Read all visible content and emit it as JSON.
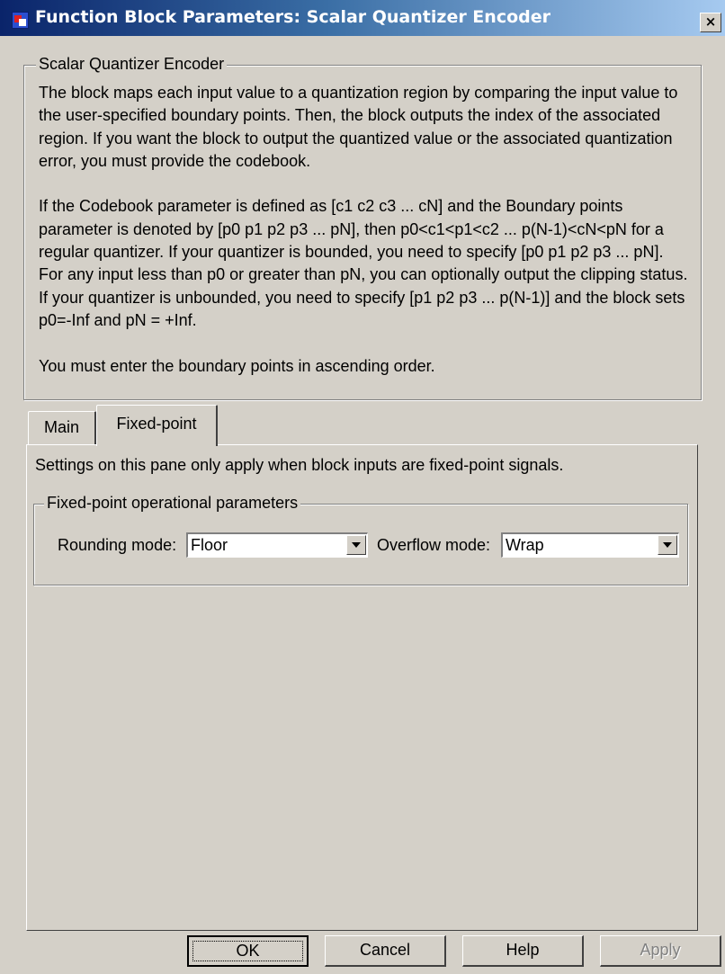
{
  "window": {
    "title": "Function Block Parameters: Scalar Quantizer Encoder",
    "close_label": "×"
  },
  "description_group": {
    "title": "Scalar Quantizer Encoder",
    "paragraphs": [
      "The block maps each input value to a quantization region by comparing the input value to the user-specified boundary points. Then, the block outputs the index of the associated region. If you want the block to output the quantized value or the associated quantization error, you must provide the codebook.",
      "If the Codebook parameter is defined as [c1 c2 c3 ... cN] and the Boundary points parameter is denoted by [p0 p1 p2 p3 ... pN], then p0<c1<p1<c2 ... p(N-1)<cN<pN for a regular quantizer. If your quantizer is bounded, you need to specify [p0 p1 p2 p3 ... pN]. For any input less than p0 or greater than pN, you can optionally output the clipping status. If your quantizer is unbounded, you need to specify [p1 p2 p3 ... p(N-1)] and the block sets p0=-Inf and pN = +Inf.",
      "You must enter the boundary points in ascending order."
    ]
  },
  "tabs": [
    {
      "label": "Main",
      "selected": false
    },
    {
      "label": "Fixed-point",
      "selected": true
    }
  ],
  "fixed_point_pane": {
    "note": "Settings on this pane only apply when block inputs are fixed-point signals.",
    "group_title": "Fixed-point operational parameters",
    "rounding_mode": {
      "label": "Rounding mode:",
      "value": "Floor"
    },
    "overflow_mode": {
      "label": "Overflow mode:",
      "value": "Wrap"
    }
  },
  "buttons": {
    "ok": "OK",
    "cancel": "Cancel",
    "help": "Help",
    "apply": "Apply"
  },
  "colors": {
    "face": "#d4d0c8",
    "title_start": "#0a246a",
    "title_end": "#a6caf0",
    "disabled_text": "#808080"
  }
}
